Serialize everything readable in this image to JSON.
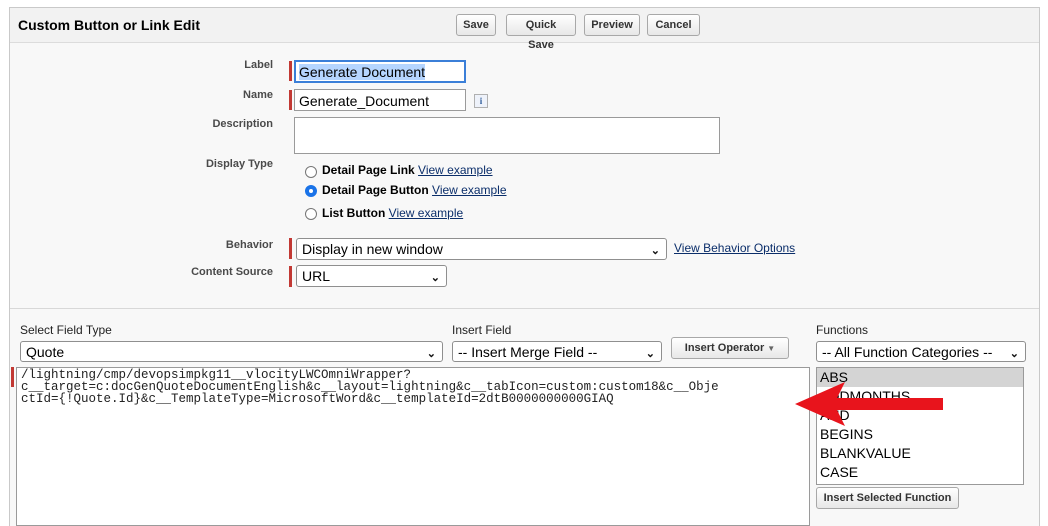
{
  "header": {
    "title": "Custom Button or Link Edit",
    "buttons": {
      "save": "Save",
      "quick_save": "Quick Save",
      "preview": "Preview",
      "cancel": "Cancel"
    }
  },
  "form": {
    "label": {
      "label": "Label",
      "value": "Generate Document"
    },
    "name": {
      "label": "Name",
      "value": "Generate_Document",
      "info": "i"
    },
    "description": {
      "label": "Description",
      "value": ""
    },
    "display_type": {
      "label": "Display Type",
      "options": [
        {
          "label": "Detail Page Link",
          "link": "View example",
          "checked": false
        },
        {
          "label": "Detail Page Button",
          "link": "View example",
          "checked": true
        },
        {
          "label": "List Button",
          "link": "View example",
          "checked": false
        }
      ]
    },
    "behavior": {
      "label": "Behavior",
      "value": "Display in new window",
      "link": "View Behavior Options"
    },
    "content_source": {
      "label": "Content Source",
      "value": "URL"
    }
  },
  "formula_editor": {
    "select_field_type": {
      "label": "Select Field Type",
      "value": "Quote"
    },
    "insert_field": {
      "label": "Insert Field",
      "value": "-- Insert Merge Field --"
    },
    "insert_operator": "Insert Operator",
    "functions": {
      "label": "Functions",
      "category": "-- All Function Categories --",
      "items": [
        "ABS",
        "ADDMONTHS",
        "AND",
        "BEGINS",
        "BLANKVALUE",
        "CASE"
      ],
      "selected_index": 0,
      "insert_button": "Insert Selected Function"
    },
    "code": "/lightning/cmp/devopsimpkg11__vlocityLWCOmniWrapper?\nc__target=c:docGenQuoteDocumentEnglish&c__layout=lightning&c__tabIcon=custom:custom18&c__Obje\nctId={!Quote.Id}&c__TemplateType=MicrosoftWord&c__templateId=2dtB0000000000GIAQ"
  },
  "annotation": {
    "arrow_color": "#e8141c"
  },
  "colors": {
    "required": "#c23934",
    "link": "#0b2e6a",
    "focus": "#3b7fd8"
  }
}
